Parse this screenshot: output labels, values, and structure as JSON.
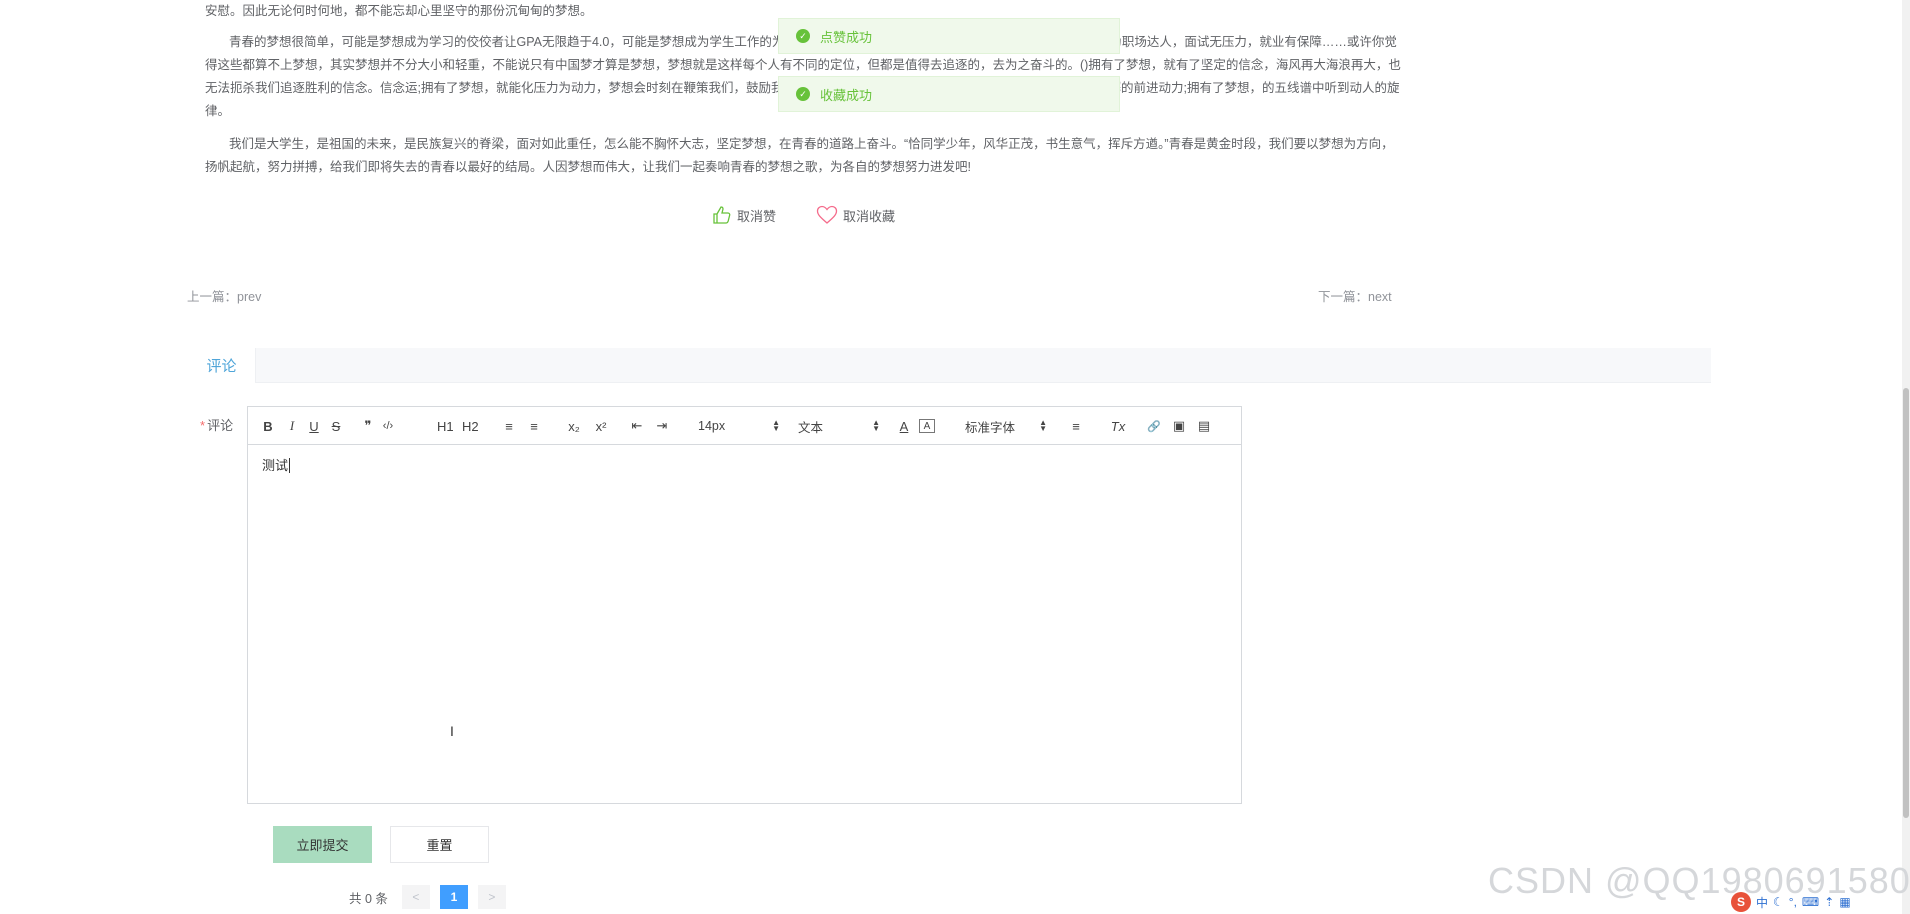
{
  "article": {
    "paragraphs": [
      "安慰。因此无论何时何地，都不能忘却心里坚守的那份沉甸甸的梦想。",
      "青春的梦想很简单，可能是梦想成为学习的佼佼者让GPA无限趋于4.0，可能是梦想成为学生工作的为运动场上的超级明星拥有大量的球迷粉丝，也可能是梦想成为职场达人，面试无压力，就业有保障……或许你觉得这些都算不上梦想，其实梦想并不分大小和轻重，不能说只有中国梦才算是梦想，梦想就是这样每个人有不同的定位，但都是值得去追逐的，去为之奋斗的。()拥有了梦想，就有了坚定的信念，海风再大海浪再大，也无法扼杀我们追逐胜利的信念。信念运;拥有了梦想，就能化压力为动力，梦想会时刻在鞭策我们，鼓励我们，让我们审视自己，发现不足，奋力补救，让自己保持不懈的前进动力;拥有了梦想，的五线谱中听到动人的旋律。",
      "我们是大学生，是祖国的未来，是民族复兴的脊梁，面对如此重任，怎么能不胸怀大志，坚定梦想，在青春的道路上奋斗。“恰同学少年，风华正茂，书生意气，挥斥方遒。”青春是黄金时段，我们要以梦想为方向，扬帆起航，努力拼搏，给我们即将失去的青春以最好的结局。人因梦想而伟大，让我们一起奏响青春的梦想之歌，为各自的梦想努力进发吧!"
    ]
  },
  "actions": {
    "unlike_label": "取消赞",
    "unfavorite_label": "取消收藏"
  },
  "nav": {
    "prev_label": "上一篇：prev",
    "next_label": "下一篇：next"
  },
  "comment_tab": {
    "label": "评论"
  },
  "form": {
    "required_mark": "*",
    "comment_label": "评论",
    "editor_content": "测试",
    "submit_label": "立即提交",
    "reset_label": "重置"
  },
  "toolbar": {
    "bold": "B",
    "italic": "I",
    "underline": "U",
    "strike": "S",
    "quote": "❞",
    "code": "‹/›",
    "h1": "H1",
    "h2": "H2",
    "ol": "≡",
    "ul": "≡",
    "sub": "x₂",
    "sup": "x²",
    "outdent": "⇤",
    "indent": "⇥",
    "size_value": "14px",
    "format_value": "文本",
    "color": "A",
    "bg_color": "A",
    "font_value": "标准字体",
    "align": "≡",
    "clean": "Tx",
    "link": "🔗",
    "image": "▣",
    "video": "▤"
  },
  "pagination": {
    "total_label": "共 0 条",
    "prev": "<",
    "current_page": "1",
    "next": ">"
  },
  "toasts": [
    {
      "label": "点赞成功"
    },
    {
      "label": "收藏成功"
    }
  ],
  "watermark": {
    "text": "CSDN @QQ1980691580"
  },
  "ime": {
    "logo": "S",
    "lang": "中"
  },
  "colors": {
    "accent": "#4fa5d9",
    "success": "#67c23a",
    "submit_bg": "#a9dcbf",
    "page_active": "#409eff",
    "required": "#f56c6c"
  }
}
